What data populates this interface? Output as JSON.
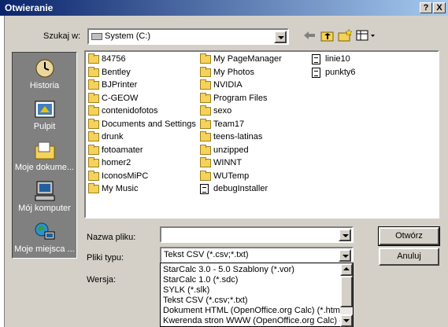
{
  "window": {
    "title": "Otwieranie",
    "help_btn": "?",
    "close_btn": "X"
  },
  "look_in": {
    "label": "Szukaj w:",
    "value": "System (C:)"
  },
  "toolbar": {
    "icons": [
      "back-arrow-icon",
      "up-folder-icon",
      "new-folder-icon",
      "view-menu-icon"
    ]
  },
  "places": [
    {
      "label": "Historia",
      "icon": "history-icon"
    },
    {
      "label": "Pulpit",
      "icon": "desktop-icon"
    },
    {
      "label": "Moje dokume...",
      "icon": "my-documents-icon"
    },
    {
      "label": "Mój komputer",
      "icon": "my-computer-icon"
    },
    {
      "label": "Moje miejsca ...",
      "icon": "network-places-icon"
    }
  ],
  "files": {
    "col1": [
      "84756",
      "Bentley",
      "BJPrinter",
      "C-GEOW",
      "contenidofotos",
      "Documents and Settings",
      "drunk",
      "fotoamater",
      "homer2",
      "IconosMiPC",
      "My Music"
    ],
    "col2": [
      "My PageManager",
      "My Photos",
      "NVIDIA",
      "Program Files",
      "sexo",
      "Team17",
      "teens-latinas",
      "unzipped",
      "WINNT",
      "WUTemp",
      "debugInstaller"
    ],
    "col2_types": [
      "folder",
      "folder",
      "folder",
      "folder",
      "folder",
      "folder",
      "folder",
      "folder",
      "folder",
      "folder",
      "doc"
    ],
    "col3": [
      "linie10",
      "punkty6"
    ]
  },
  "filename": {
    "label": "Nazwa pliku:",
    "value": ""
  },
  "filetype": {
    "label": "Pliki typu:",
    "value": "Tekst CSV (*.csv;*.txt)",
    "options": [
      "StarCalc 3.0 - 5.0 Szablony (*.vor)",
      "StarCalc 1.0 (*.sdc)",
      "SYLK (*.slk)",
      "Tekst CSV (*.csv;*.txt)",
      "Dokument HTML (OpenOffice.org Calc) (*.html;*.",
      "Kwerenda stron WWW (OpenOffice.org Calc) (*"
    ]
  },
  "version": {
    "label": "Wersja:"
  },
  "buttons": {
    "open": "Otwórz",
    "cancel": "Anuluj"
  }
}
